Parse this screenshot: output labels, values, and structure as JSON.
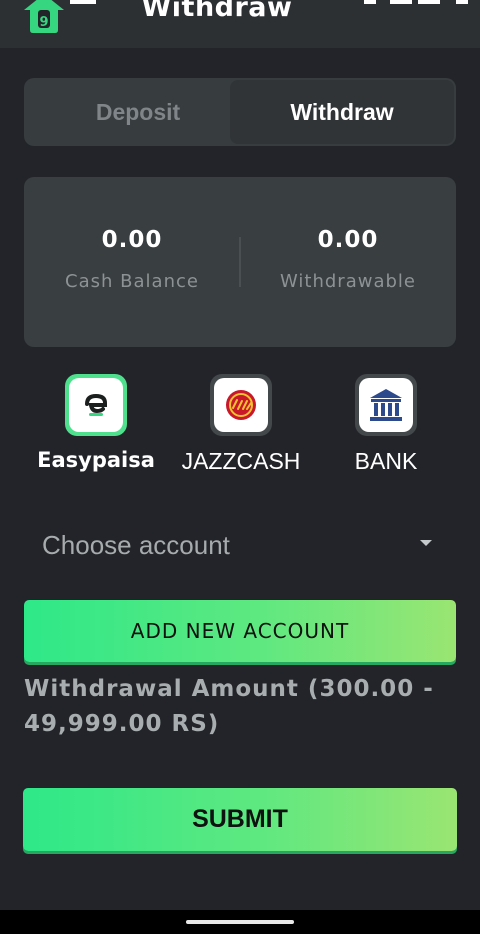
{
  "header": {
    "title": "Withdraw"
  },
  "tabs": [
    {
      "label": "Deposit",
      "active": false
    },
    {
      "label": "Withdraw",
      "active": true
    }
  ],
  "balance": {
    "cash": {
      "value": "0.00",
      "label": "Cash Balance"
    },
    "withdrawable": {
      "value": "0.00",
      "label": "Withdrawable"
    }
  },
  "methods": [
    {
      "label": "Easypaisa",
      "icon": "easypaisa-logo-icon",
      "selected": true
    },
    {
      "label": "JAZZCASH",
      "icon": "jazzcash-logo-icon",
      "selected": false
    },
    {
      "label": "BANK",
      "icon": "bank-icon",
      "selected": false
    }
  ],
  "account_select": {
    "value": "Choose account"
  },
  "add_account_button": {
    "label": "ADD NEW ACCOUNT"
  },
  "amount_label": "Withdrawal Amount (300.00 - 49,999.00 RS)",
  "submit_button": {
    "label": "SUBMIT"
  },
  "colors": {
    "background": "#222429",
    "card": "#393e40",
    "accent_green": "#2ee888",
    "accent_green_end": "#9ae572",
    "bank_blue": "#2c4a8c"
  }
}
